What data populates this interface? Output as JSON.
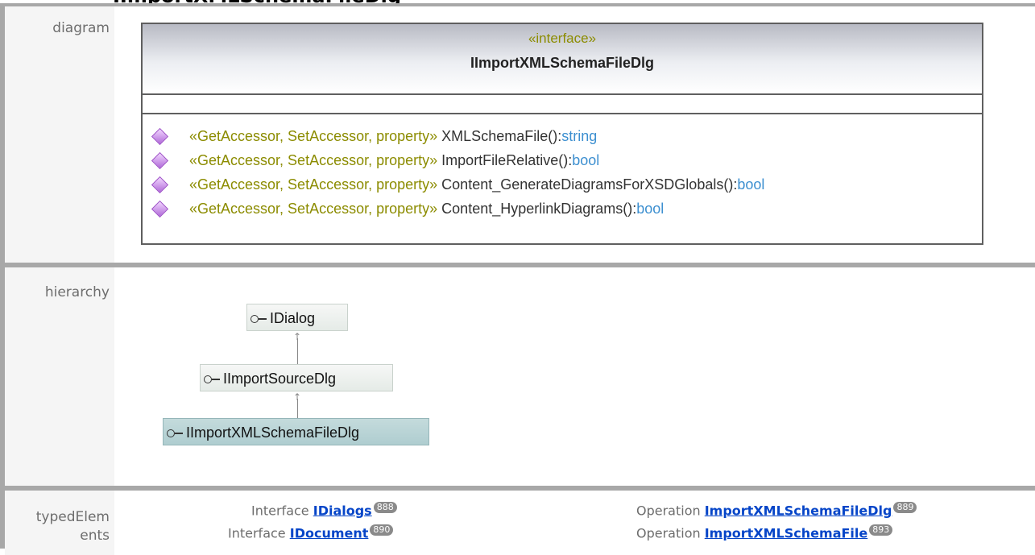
{
  "page_title": "IImportXMLSchemaFileDlg",
  "rows": {
    "diagram_label": "diagram",
    "hierarchy_label": "hierarchy",
    "typed_label": "typedElements"
  },
  "uml": {
    "stereotype": "«interface»",
    "class_name": "IImportXMLSchemaFileDlg",
    "operations": [
      {
        "stereotype": "«GetAccessor, SetAccessor, property»",
        "name": "XMLSchemaFile():",
        "type": "string"
      },
      {
        "stereotype": "«GetAccessor, SetAccessor, property»",
        "name": "ImportFileRelative():",
        "type": "bool"
      },
      {
        "stereotype": "«GetAccessor, SetAccessor, property»",
        "name": "Content_GenerateDiagramsForXSDGlobals():",
        "type": "bool"
      },
      {
        "stereotype": "«GetAccessor, SetAccessor, property»",
        "name": "Content_HyperlinkDiagrams():",
        "type": "bool"
      }
    ]
  },
  "hierarchy": [
    "IDialog",
    "IImportSourceDlg",
    "IImportXMLSchemaFileDlg"
  ],
  "typed_elements": [
    {
      "kind": "Interface",
      "name": "IDialogs",
      "page": "888"
    },
    {
      "kind": "Operation",
      "name": "ImportXMLSchemaFileDlg",
      "page": "889"
    },
    {
      "kind": "Interface",
      "name": "IDocument",
      "page": "890"
    },
    {
      "kind": "Operation",
      "name": "ImportXMLSchemaFile",
      "page": "893"
    }
  ]
}
